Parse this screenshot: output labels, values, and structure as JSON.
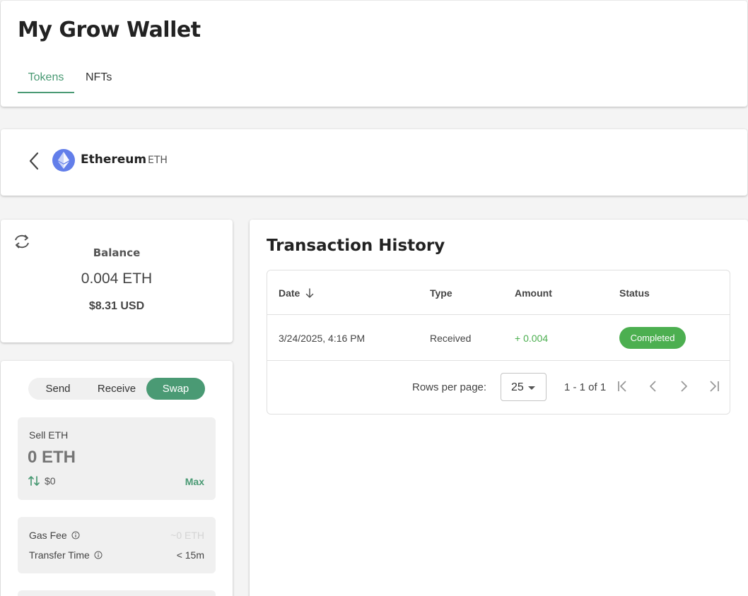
{
  "app": {
    "title": "My Grow Wallet"
  },
  "tabs": [
    {
      "label": "Tokens",
      "active": true
    },
    {
      "label": "NFTs",
      "active": false
    }
  ],
  "asset": {
    "name": "Ethereum",
    "symbol": "ETH",
    "icon": "ethereum-icon"
  },
  "balance": {
    "label": "Balance",
    "amount": "0.004 ETH",
    "usd": "$8.31 USD"
  },
  "actions": {
    "modes": [
      "Send",
      "Receive",
      "Swap"
    ],
    "selected": "Swap",
    "sell": {
      "label": "Sell ETH",
      "placeholder": "0 ETH",
      "usd": "$0",
      "max_label": "Max"
    },
    "fees": [
      {
        "label": "Gas Fee",
        "value": "~0 ETH"
      },
      {
        "label": "Transfer Time",
        "value": "< 15m"
      }
    ]
  },
  "history": {
    "title": "Transaction History",
    "columns": [
      "Date",
      "Type",
      "Amount",
      "Status"
    ],
    "rows": [
      {
        "date": "3/24/2025, 4:16 PM",
        "type": "Received",
        "amount": "+ 0.004",
        "status": "Completed"
      }
    ],
    "pagination": {
      "rows_label": "Rows per page:",
      "rows_per_page": "25",
      "range": "1 - 1 of 1"
    }
  },
  "colors": {
    "accent": "#4a9a74",
    "success": "#4caf50",
    "eth": "#627eea"
  }
}
